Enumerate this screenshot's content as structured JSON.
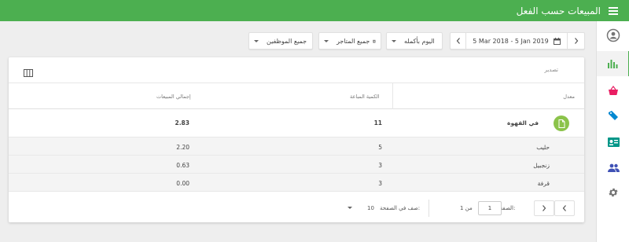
{
  "header": {
    "title": "المبيعات حسب الفعل"
  },
  "filters": {
    "date_range": "5 Mar 2018 - 5 Jan 2019",
    "time": "اليوم بأكمله",
    "stores": "جميع المتاجر",
    "employees": "جميع الموظفين"
  },
  "card": {
    "export_label": "تصدير"
  },
  "table": {
    "headers": {
      "item": "معدل",
      "quantity": "الكمية المباعة",
      "total": "إجمالي المبيعات"
    },
    "group": {
      "name": "في القهوة",
      "quantity": "11",
      "total": "2.83"
    },
    "rows": [
      {
        "name": "حليب",
        "quantity": "5",
        "total": "2.20"
      },
      {
        "name": "زنجبيل",
        "quantity": "3",
        "total": "0.63"
      },
      {
        "name": "قرفة",
        "quantity": "3",
        "total": "0.00"
      }
    ]
  },
  "pagination": {
    "page_label": "الصفحة:",
    "page_value": "1",
    "of_label": "من 1",
    "rows_label": "صف في الصفحة:",
    "rows_value": "10"
  },
  "colors": {
    "primary": "#4caf50",
    "accent_pink": "#e91e63",
    "accent_blue": "#0288d1",
    "accent_teal": "#009688",
    "indigo": "#3f51b5"
  }
}
